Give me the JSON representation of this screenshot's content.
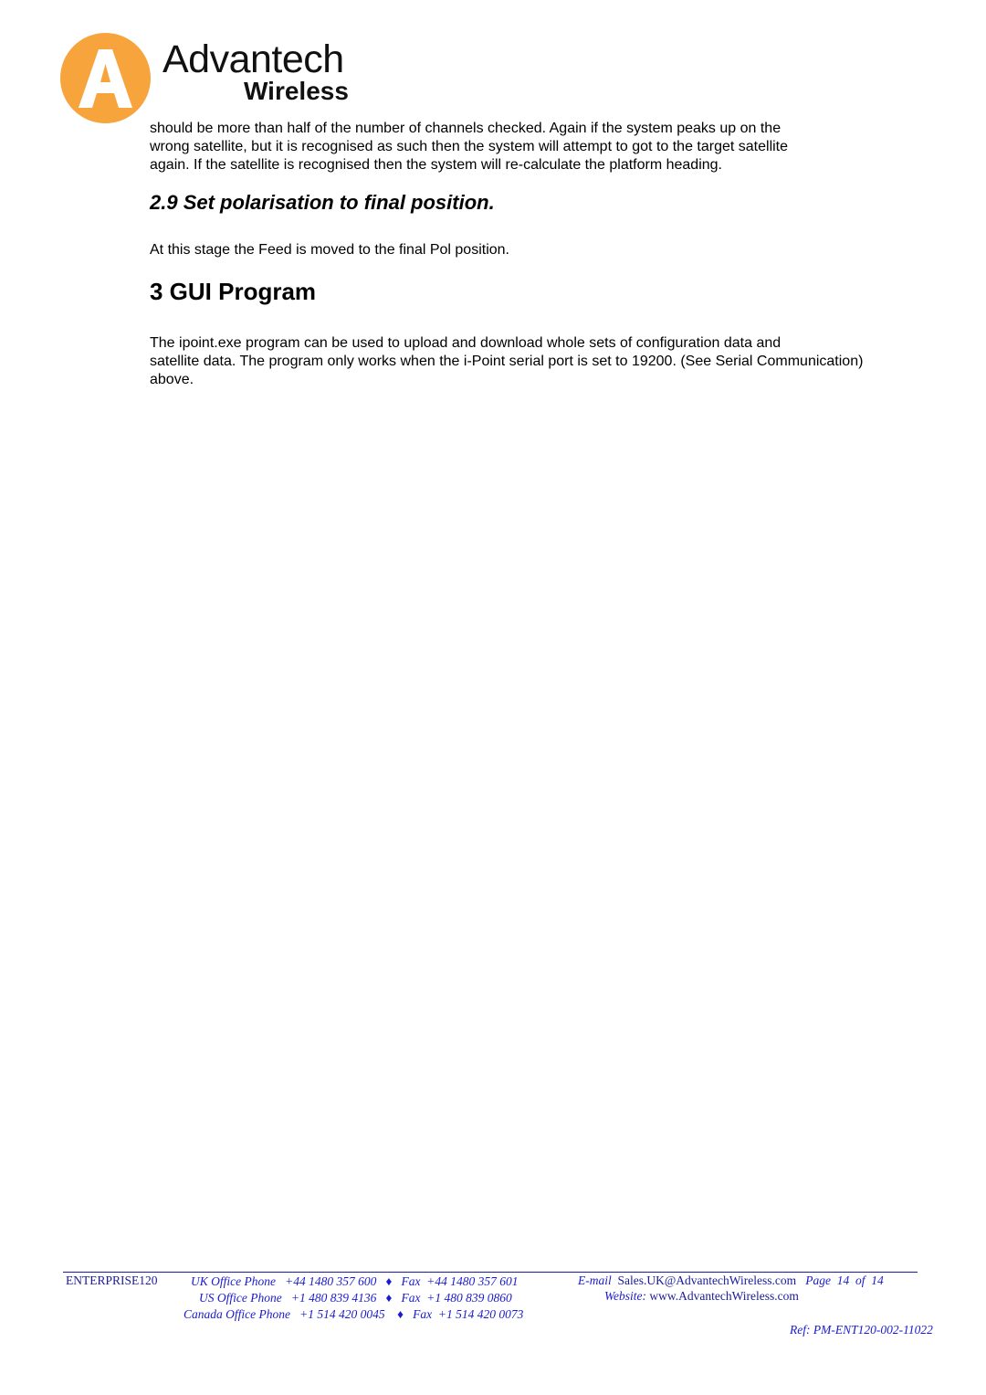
{
  "header": {
    "logo_letter": "A",
    "brand": "Advantech",
    "brand_sub": "Wireless",
    "brand_color": "#f7a43c"
  },
  "content": {
    "paragraph_1": "should be more than half of the number of channels checked. Again if the system peaks up on the wrong satellite, but it is recognised as such then the system will attempt to got to the target satellite again. If the satellite is recognised then the system will re-calculate the platform heading.",
    "paragraph_1_lines": [
      "should be more than half of the number of channels checked. Again if the system peaks up on the",
      "wrong satellite, but it is recognised as such then the system will attempt to got to the target satellite",
      "again. If the satellite is recognised then the system will re-calculate the platform heading."
    ],
    "heading_2_9": "2.9 Set polarisation to final position.",
    "paragraph_2": "At this stage the Feed is moved to the final Pol position.",
    "heading_3": "3 GUI Program",
    "paragraph_3_lines": [
      "The ipoint.exe program can be used to upload and download whole sets of configuration data and",
      "satellite data. The program only works when the i-Point serial port is set to 19200. (See Serial Communication)",
      "above."
    ]
  },
  "footer": {
    "model": "ENTERPRISE120",
    "uk_label": "UK Office Phone",
    "uk_phone": "+44 1480 357 600",
    "uk_fax_label": "Fax",
    "uk_fax": "+44 1480 357 601",
    "us_label": "US Office Phone",
    "us_phone": "+1 480 839 4136",
    "us_fax_label": "Fax",
    "us_fax": "+1 480 839 0860",
    "ca_label": "Canada Office Phone",
    "ca_phone": "+1 514 420 0045",
    "ca_fax_label": "Fax",
    "ca_fax": "+1 514 420 0073",
    "separator": "♦",
    "email_label": "E-mail",
    "email": "Sales.UK@AdvantechWireless.com",
    "page_label": "Page",
    "page_current": "14",
    "page_of": "of",
    "page_total": "14",
    "website_label": "Website:",
    "website": "www.AdvantechWireless.com",
    "ref": "Ref: PM-ENT120-002-11022",
    "color": "#1a1ad0"
  }
}
